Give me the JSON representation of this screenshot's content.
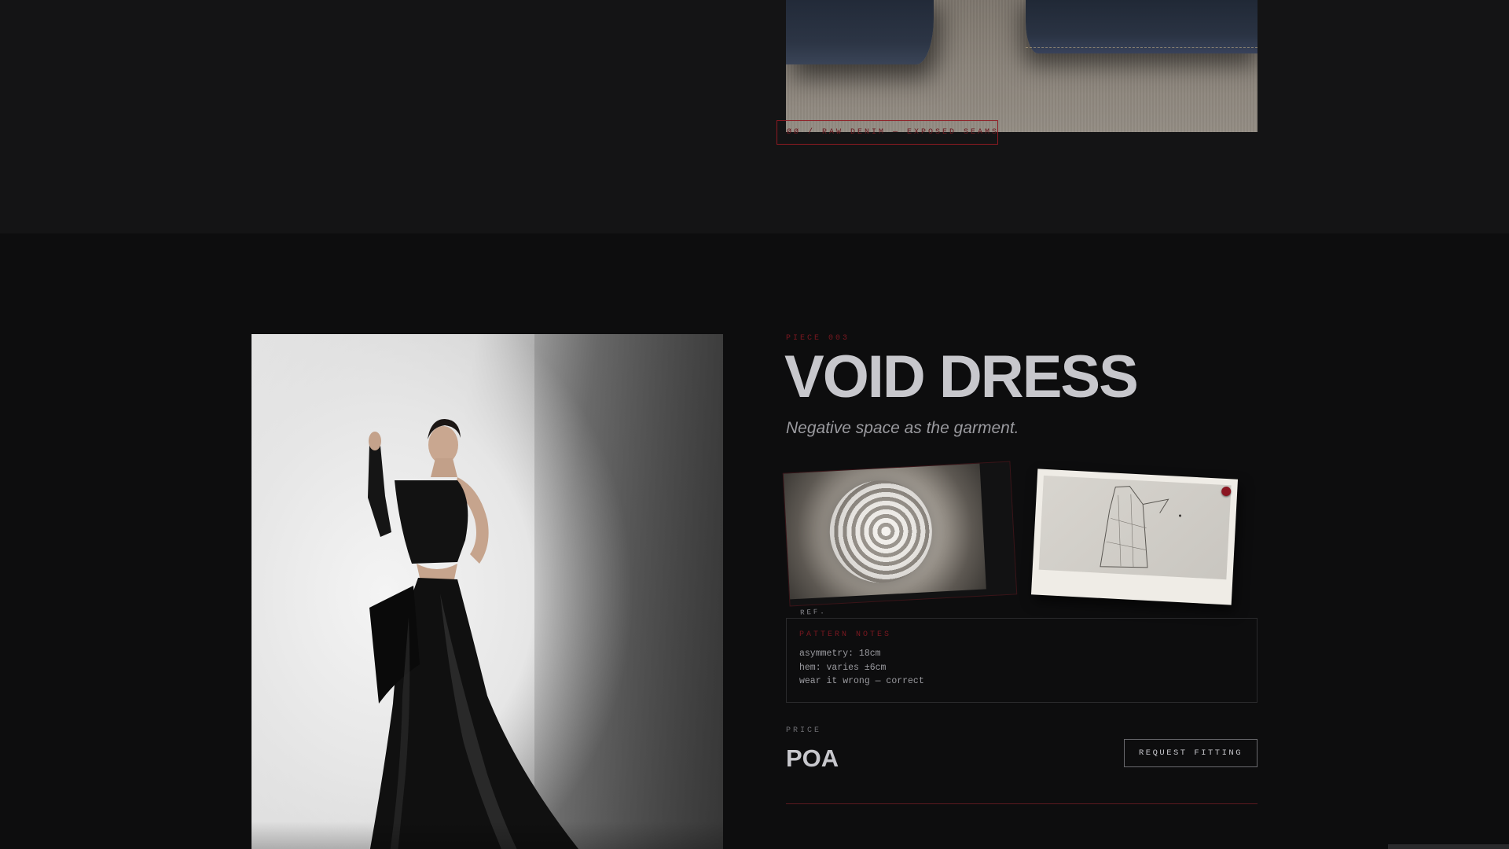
{
  "previous_piece": {
    "caption": "ØØ / RAW DENIM — EXPOSED SEAMS"
  },
  "piece": {
    "label": "PIECE 003",
    "title": "VOID DRESS",
    "tagline": "Negative space as the garment.",
    "reference_label": "REF.",
    "pattern_notes": {
      "title": "PATTERN NOTES",
      "lines": [
        "asymmetry: 18cm",
        "hem: varies ±6cm",
        "wear it wrong — correct"
      ]
    },
    "price": {
      "label": "PRICE",
      "value": "POA"
    },
    "cta_label": "REQUEST FITTING"
  },
  "colors": {
    "background": "#0d0d0e",
    "section_alt": "#141415",
    "accent": "#8e1a22",
    "title": "#c7c7cc"
  }
}
